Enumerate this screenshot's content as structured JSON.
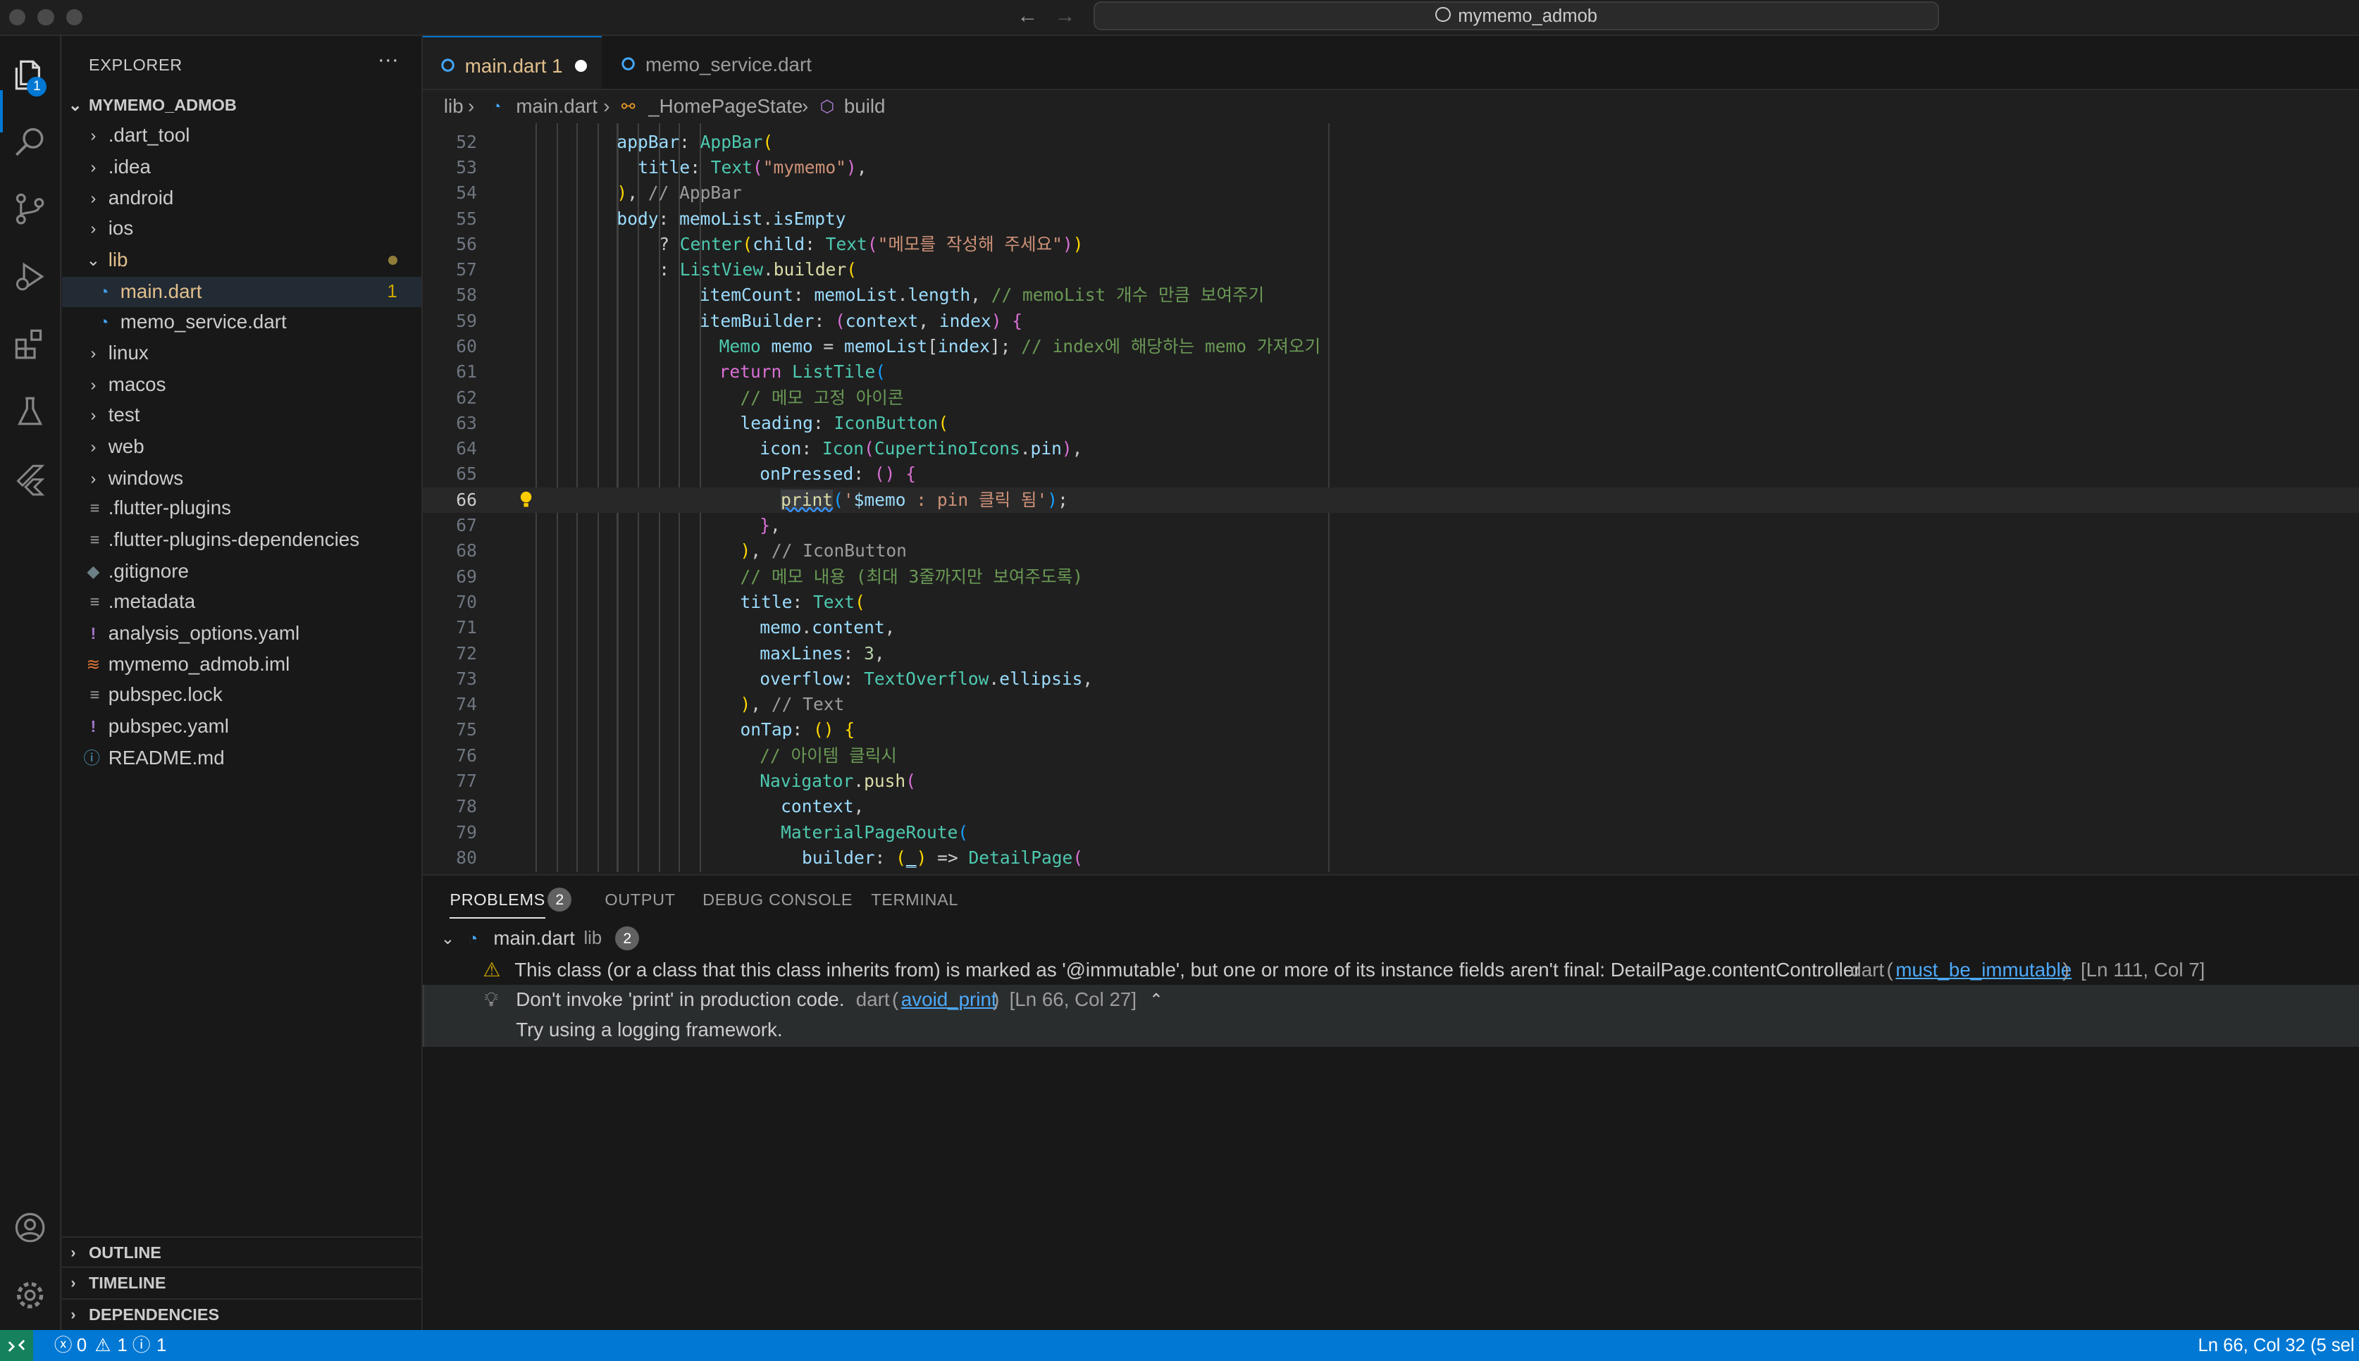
{
  "window": {
    "title": "mymemo_admob"
  },
  "activity_bar": {
    "explorer_badge": "1"
  },
  "explorer": {
    "title": "EXPLORER",
    "more_glyph": "···",
    "root": "MYMEMO_ADMOB",
    "items": [
      {
        "label": ".dart_tool",
        "type": "folder"
      },
      {
        "label": ".idea",
        "type": "folder"
      },
      {
        "label": "android",
        "type": "folder"
      },
      {
        "label": "ios",
        "type": "folder"
      },
      {
        "label": "lib",
        "type": "folder-open"
      },
      {
        "label": "main.dart",
        "type": "dart",
        "problems": "1"
      },
      {
        "label": "memo_service.dart",
        "type": "dart"
      },
      {
        "label": "linux",
        "type": "folder"
      },
      {
        "label": "macos",
        "type": "folder"
      },
      {
        "label": "test",
        "type": "folder"
      },
      {
        "label": "web",
        "type": "folder"
      },
      {
        "label": "windows",
        "type": "folder"
      },
      {
        "label": ".flutter-plugins",
        "type": "file"
      },
      {
        "label": ".flutter-plugins-dependencies",
        "type": "file"
      },
      {
        "label": ".gitignore",
        "type": "git"
      },
      {
        "label": ".metadata",
        "type": "file"
      },
      {
        "label": "analysis_options.yaml",
        "type": "yaml"
      },
      {
        "label": "mymemo_admob.iml",
        "type": "rss"
      },
      {
        "label": "pubspec.lock",
        "type": "file"
      },
      {
        "label": "pubspec.yaml",
        "type": "yaml"
      },
      {
        "label": "README.md",
        "type": "info"
      }
    ],
    "sections": [
      "OUTLINE",
      "TIMELINE",
      "DEPENDENCIES"
    ]
  },
  "tabs": [
    {
      "label": "main.dart",
      "suffix": "1",
      "active": true,
      "dirty": true
    },
    {
      "label": "memo_service.dart",
      "active": false
    }
  ],
  "breadcrumb": [
    "lib",
    "main.dart",
    "_HomePageState",
    "build"
  ],
  "code": {
    "line_numbers": [
      "52",
      "53",
      "54",
      "55",
      "56",
      "57",
      "58",
      "59",
      "60",
      "61",
      "62",
      "63",
      "64",
      "65",
      "66",
      "67",
      "68",
      "69",
      "70",
      "71",
      "72",
      "73",
      "74",
      "75",
      "76",
      "77",
      "78",
      "79",
      "80"
    ],
    "current_line": "66"
  },
  "panel": {
    "tabs": [
      "PROBLEMS",
      "OUTPUT",
      "DEBUG CONSOLE",
      "TERMINAL"
    ],
    "problems_count": "2",
    "file": {
      "name": "main.dart",
      "dir": "lib",
      "count": "2"
    },
    "problems": [
      {
        "severity": "warning",
        "message": "This class (or a class that this class inherits from) is marked as '@immutable', but one or more of its instance fields aren't final: DetailPage.contentController",
        "source": "dart",
        "code": "must_be_immutable",
        "location": "[Ln 111, Col 7]"
      },
      {
        "severity": "info",
        "message": "Don't invoke 'print' in production code.",
        "source": "dart",
        "code": "avoid_print",
        "location": "[Ln 66, Col 27]",
        "detail": "Try using a logging framework."
      }
    ]
  },
  "status_bar": {
    "errors": "0",
    "warnings": "1",
    "infos": "1",
    "cursor": "Ln 66, Col 32 (5 sel"
  },
  "colors": {
    "accent": "#0078d4",
    "remote": "#16825d",
    "modified": "#e2c08d"
  }
}
